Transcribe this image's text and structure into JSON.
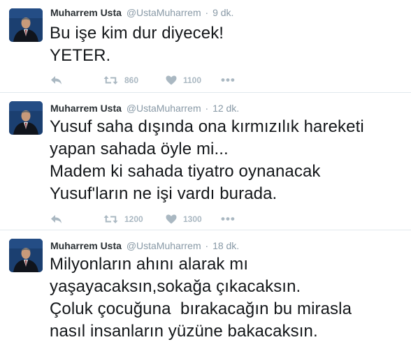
{
  "tweets": [
    {
      "fullname": "Muharrem Usta",
      "username": "@UstaMuharrem",
      "separator": "·",
      "time": "9 dk.",
      "text": "Bu işe kim dur diyecek!\nYETER.",
      "retweets": "860",
      "likes": "1100",
      "more": "•••",
      "icons": [
        "reply-icon",
        "retweet-icon",
        "heart-icon",
        "more-icon"
      ]
    },
    {
      "fullname": "Muharrem Usta",
      "username": "@UstaMuharrem",
      "separator": "·",
      "time": "12 dk.",
      "text": "Yusuf saha dışında ona kırmızılık hareketi\nyapan sahada öyle mi...\nMadem ki sahada tiyatro oynanacak\nYusuf'ların ne işi vardı burada.",
      "retweets": "1200",
      "likes": "1300",
      "more": "•••",
      "icons": [
        "reply-icon",
        "retweet-icon",
        "heart-icon",
        "more-icon"
      ]
    },
    {
      "fullname": "Muharrem Usta",
      "username": "@UstaMuharrem",
      "separator": "·",
      "time": "18 dk.",
      "text": "Milyonların ahını alarak mı\nyaşayacaksın,sokağa çıkacaksın.\nÇoluk çocuğuna  bırakacağın bu mirasla\nnasıl insanların yüzüne bakacaksın."
    }
  ],
  "colors": {
    "name": "#292f33",
    "meta": "#8899a6",
    "text": "#14171a",
    "action": "#aab8c2",
    "divider": "#e1e8ed",
    "avatar_background": "#1a3f6f"
  }
}
